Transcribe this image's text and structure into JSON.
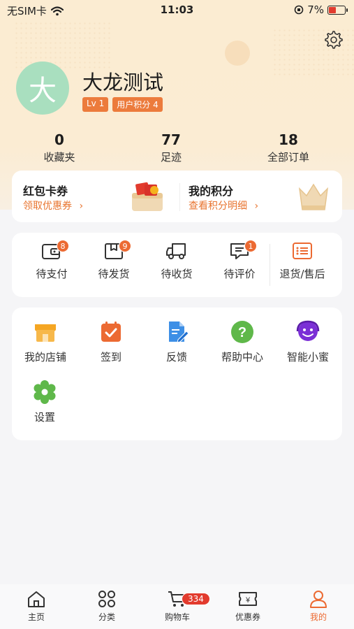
{
  "status_bar": {
    "carrier": "无SIM卡",
    "time": "11:03",
    "battery": "7%"
  },
  "profile": {
    "avatar_char": "大",
    "username": "大龙测试",
    "level": "Lv 1",
    "points_badge": "用户积分 4"
  },
  "stats": [
    {
      "value": "0",
      "label": "收藏夹"
    },
    {
      "value": "77",
      "label": "足迹"
    },
    {
      "value": "18",
      "label": "全部订单"
    }
  ],
  "promo": {
    "coupons_title": "红包卡券",
    "coupons_link": "领取优惠券",
    "points_title": "我的积分",
    "points_link": "查看积分明细"
  },
  "orders": [
    {
      "label": "待支付",
      "badge": "8",
      "icon": "wallet-icon"
    },
    {
      "label": "待发货",
      "badge": "9",
      "icon": "package-icon"
    },
    {
      "label": "待收货",
      "badge": "",
      "icon": "truck-icon"
    },
    {
      "label": "待评价",
      "badge": "1",
      "icon": "comment-icon"
    },
    {
      "label": "退货/售后",
      "badge": "",
      "icon": "list-icon"
    }
  ],
  "tools": [
    {
      "label": "我的店铺",
      "icon": "store-icon"
    },
    {
      "label": "签到",
      "icon": "calendar-check-icon"
    },
    {
      "label": "反馈",
      "icon": "document-edit-icon"
    },
    {
      "label": "帮助中心",
      "icon": "help-icon"
    },
    {
      "label": "智能小蜜",
      "icon": "assistant-icon"
    },
    {
      "label": "设置",
      "icon": "settings-icon"
    }
  ],
  "tabbar": [
    {
      "label": "主页",
      "icon": "home-icon"
    },
    {
      "label": "分类",
      "icon": "category-icon"
    },
    {
      "label": "购物车",
      "icon": "cart-icon",
      "badge": "334"
    },
    {
      "label": "优惠券",
      "icon": "coupon-icon"
    },
    {
      "label": "我的",
      "icon": "profile-icon",
      "active": true
    }
  ],
  "colors": {
    "accent": "#ec6a32",
    "hero_bg": "#fbecd2",
    "avatar_bg": "#a9dfbf"
  }
}
